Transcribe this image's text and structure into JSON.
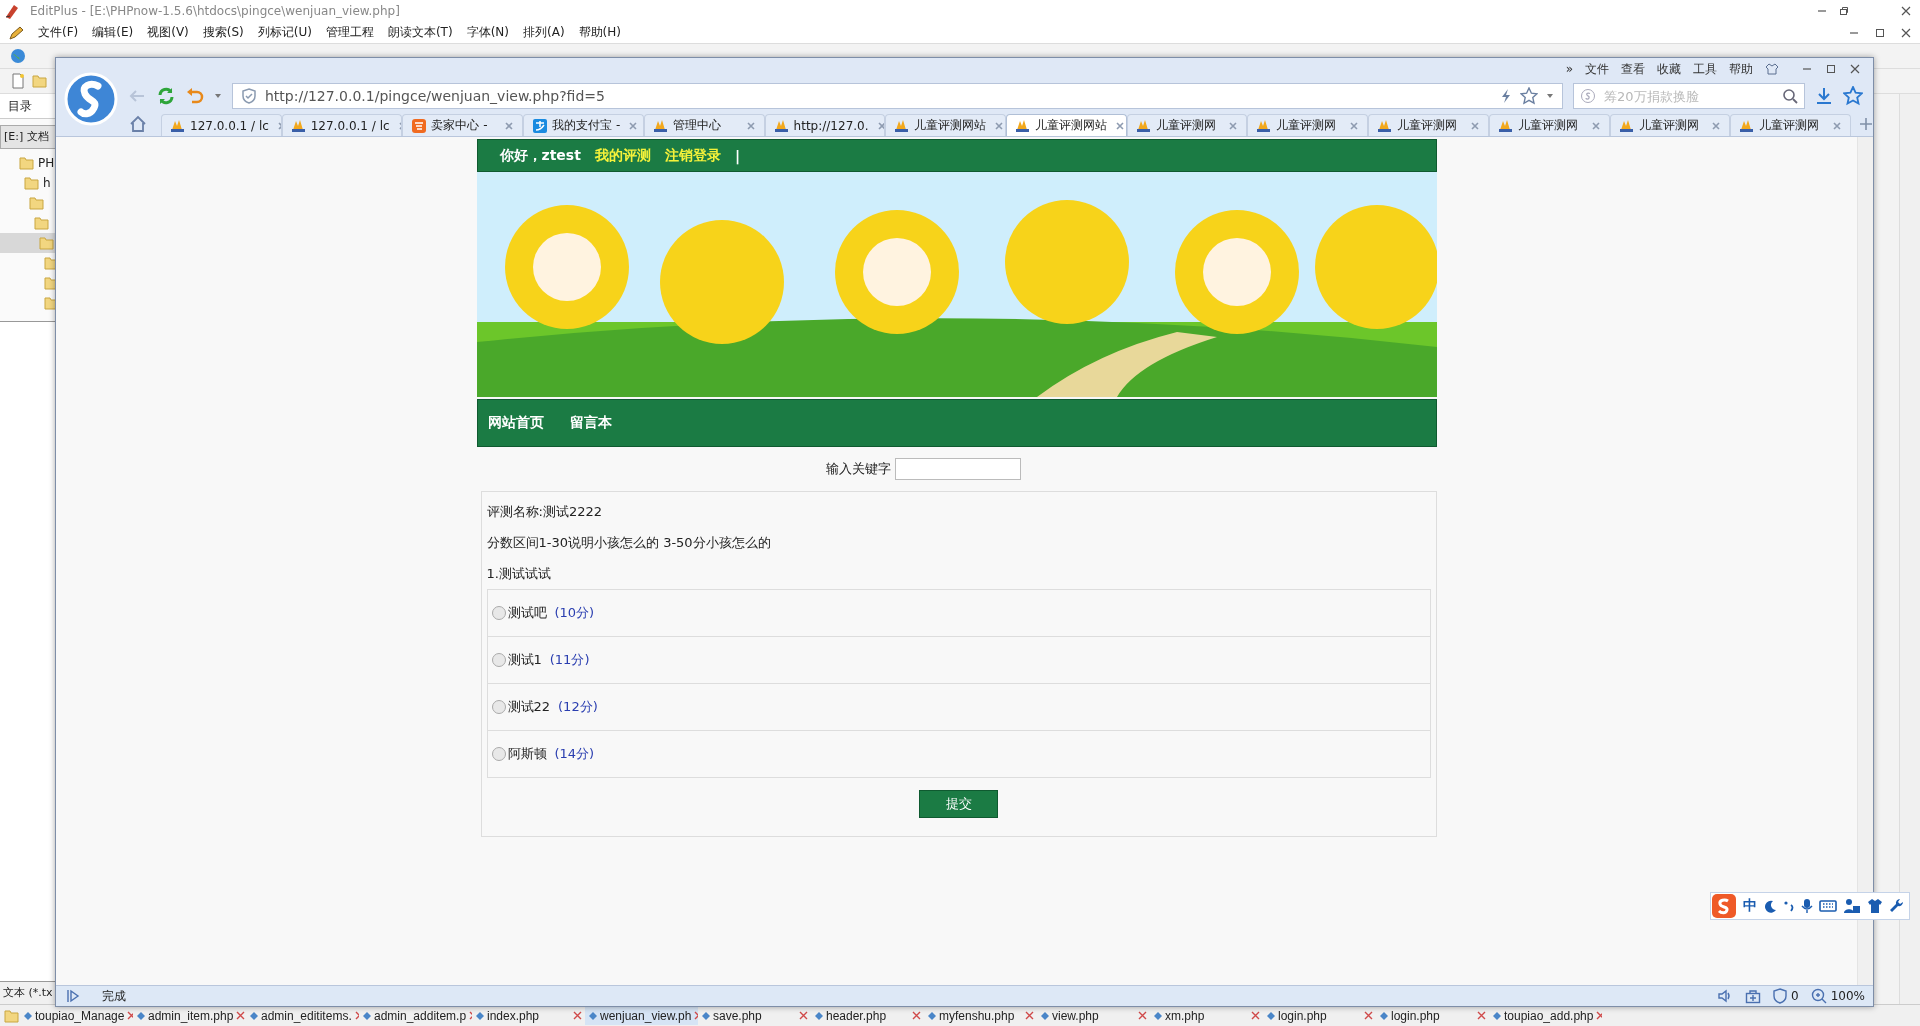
{
  "editor": {
    "title": "EditPlus - [E:\\PHPnow-1.5.6\\htdocs\\pingce\\wenjuan_view.php]",
    "menu": [
      "文件(F)",
      "编辑(E)",
      "视图(V)",
      "搜索(S)",
      "列标记(U)",
      "管理工程",
      "朗读文本(T)",
      "字体(N)",
      "排列(A)",
      "帮助(H)"
    ],
    "sidebar": {
      "tab": "目录",
      "drive": "[E:] 文档",
      "tree": [
        {
          "label": "PH",
          "selected": false,
          "children": [
            {
              "label": "h",
              "selected": false,
              "children": [
                {
                  "selected": false,
                  "children": [
                    {
                      "selected": false,
                      "children": [
                        {
                          "selected": true,
                          "children": [
                            {
                              "selected": false
                            },
                            {
                              "selected": false
                            },
                            {
                              "selected": false
                            }
                          ]
                        }
                      ]
                    }
                  ]
                }
              ]
            }
          ]
        }
      ],
      "filter": "文本 (*.tx"
    },
    "file_tabs": [
      {
        "label": "toupiao_Manage",
        "selected": false
      },
      {
        "label": "admin_item.php",
        "selected": false
      },
      {
        "label": "admin_edititems.",
        "selected": false
      },
      {
        "label": "admin_additem.p",
        "selected": false
      },
      {
        "label": "index.php",
        "selected": false
      },
      {
        "label": "wenjuan_view.ph",
        "selected": true
      },
      {
        "label": "save.php",
        "selected": false
      },
      {
        "label": "header.php",
        "selected": false
      },
      {
        "label": "myfenshu.php",
        "selected": false
      },
      {
        "label": "view.php",
        "selected": false
      },
      {
        "label": "xm.php",
        "selected": false
      },
      {
        "label": "login.php",
        "selected": false
      },
      {
        "label": "login.php",
        "selected": false
      },
      {
        "label": "toupiao_add.php",
        "selected": false
      }
    ]
  },
  "browser": {
    "more": "»",
    "menu": [
      "文件",
      "查看",
      "收藏",
      "工具",
      "帮助"
    ],
    "url": "http://127.0.0.1/pingce/wenjuan_view.php?fid=5",
    "search": {
      "placeholder": "筹20万捐款换脸"
    },
    "tabs": [
      {
        "title": "127.0.0.1 / lc",
        "kind": "pma",
        "selected": false
      },
      {
        "title": "127.0.0.1 / lc",
        "kind": "pma",
        "selected": false
      },
      {
        "title": "卖家中心 -",
        "kind": "shop",
        "selected": false
      },
      {
        "title": "我的支付宝 -",
        "kind": "pay",
        "selected": false
      },
      {
        "title": "管理中心",
        "kind": "pma",
        "selected": false
      },
      {
        "title": "http://127.0.",
        "kind": "pma",
        "selected": false
      },
      {
        "title": "儿童评测网站",
        "kind": "pma",
        "selected": false
      },
      {
        "title": "儿童评测网站",
        "kind": "pma",
        "selected": true
      },
      {
        "title": "儿童评测网",
        "kind": "pma",
        "selected": false
      },
      {
        "title": "儿童评测网",
        "kind": "pma",
        "selected": false
      },
      {
        "title": "儿童评测网",
        "kind": "pma",
        "selected": false
      },
      {
        "title": "儿童评测网",
        "kind": "pma",
        "selected": false
      },
      {
        "title": "儿童评测网",
        "kind": "pma",
        "selected": false
      },
      {
        "title": "儿童评测网",
        "kind": "pma",
        "selected": false
      }
    ],
    "page": {
      "greeting": "你好，ztest",
      "links": [
        "我的评测",
        "注销登录"
      ],
      "separator": "|",
      "banner": {
        "kind": "picture"
      },
      "nav": [
        "网站首页",
        "留言本"
      ],
      "search_label": "输入关键字",
      "title": "评测名称:测试2222",
      "description": "分数区间1-30说明小孩怎么的 3-50分小孩怎么的",
      "question": "1.测试试试",
      "options": [
        {
          "label": "测试吧",
          "score": "(10分)",
          "selected": false
        },
        {
          "label": "测试1",
          "score": "(11分)",
          "selected": false
        },
        {
          "label": "测试22",
          "score": "(12分)",
          "selected": false
        },
        {
          "label": "阿斯顿",
          "score": "(14分)",
          "selected": false
        }
      ],
      "submit": "提交"
    },
    "status": {
      "text": "完成",
      "ad_count": "0",
      "zoom": "100%"
    },
    "ime": {
      "mode": "中"
    }
  }
}
